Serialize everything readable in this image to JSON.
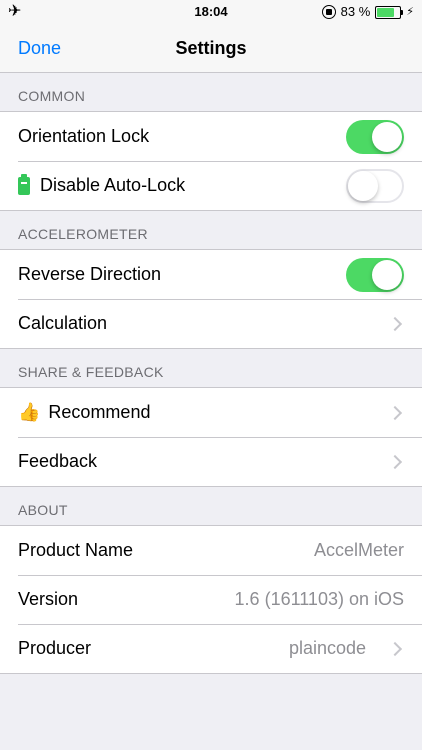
{
  "status_bar": {
    "time": "18:04",
    "battery_percent": "83 %",
    "battery_level": 0.83,
    "icons": [
      "airplane-icon",
      "rotation-lock-icon",
      "battery-icon",
      "charging-bolt-icon"
    ]
  },
  "nav": {
    "done_label": "Done",
    "title": "Settings"
  },
  "sections": {
    "common": {
      "header": "COMMON",
      "orientation_lock": {
        "label": "Orientation Lock",
        "on": true
      },
      "disable_autolock": {
        "label": "Disable Auto-Lock",
        "on": false,
        "icon": "battery-icon"
      }
    },
    "accelerometer": {
      "header": "ACCELEROMETER",
      "reverse_direction": {
        "label": "Reverse Direction",
        "on": true
      },
      "calculation": {
        "label": "Calculation"
      }
    },
    "share": {
      "header": "SHARE & FEEDBACK",
      "recommend": {
        "label": "Recommend",
        "emoji": "👍"
      },
      "feedback": {
        "label": "Feedback"
      }
    },
    "about": {
      "header": "ABOUT",
      "product_name": {
        "label": "Product Name",
        "value": "AccelMeter"
      },
      "version": {
        "label": "Version",
        "value": "1.6 (1611103) on iOS"
      },
      "producer": {
        "label": "Producer",
        "value": "plaincode"
      }
    }
  },
  "colors": {
    "accent": "#007aff",
    "switch_on": "#4cd964",
    "background": "#efeff4",
    "secondary_text": "#8e8e93"
  }
}
